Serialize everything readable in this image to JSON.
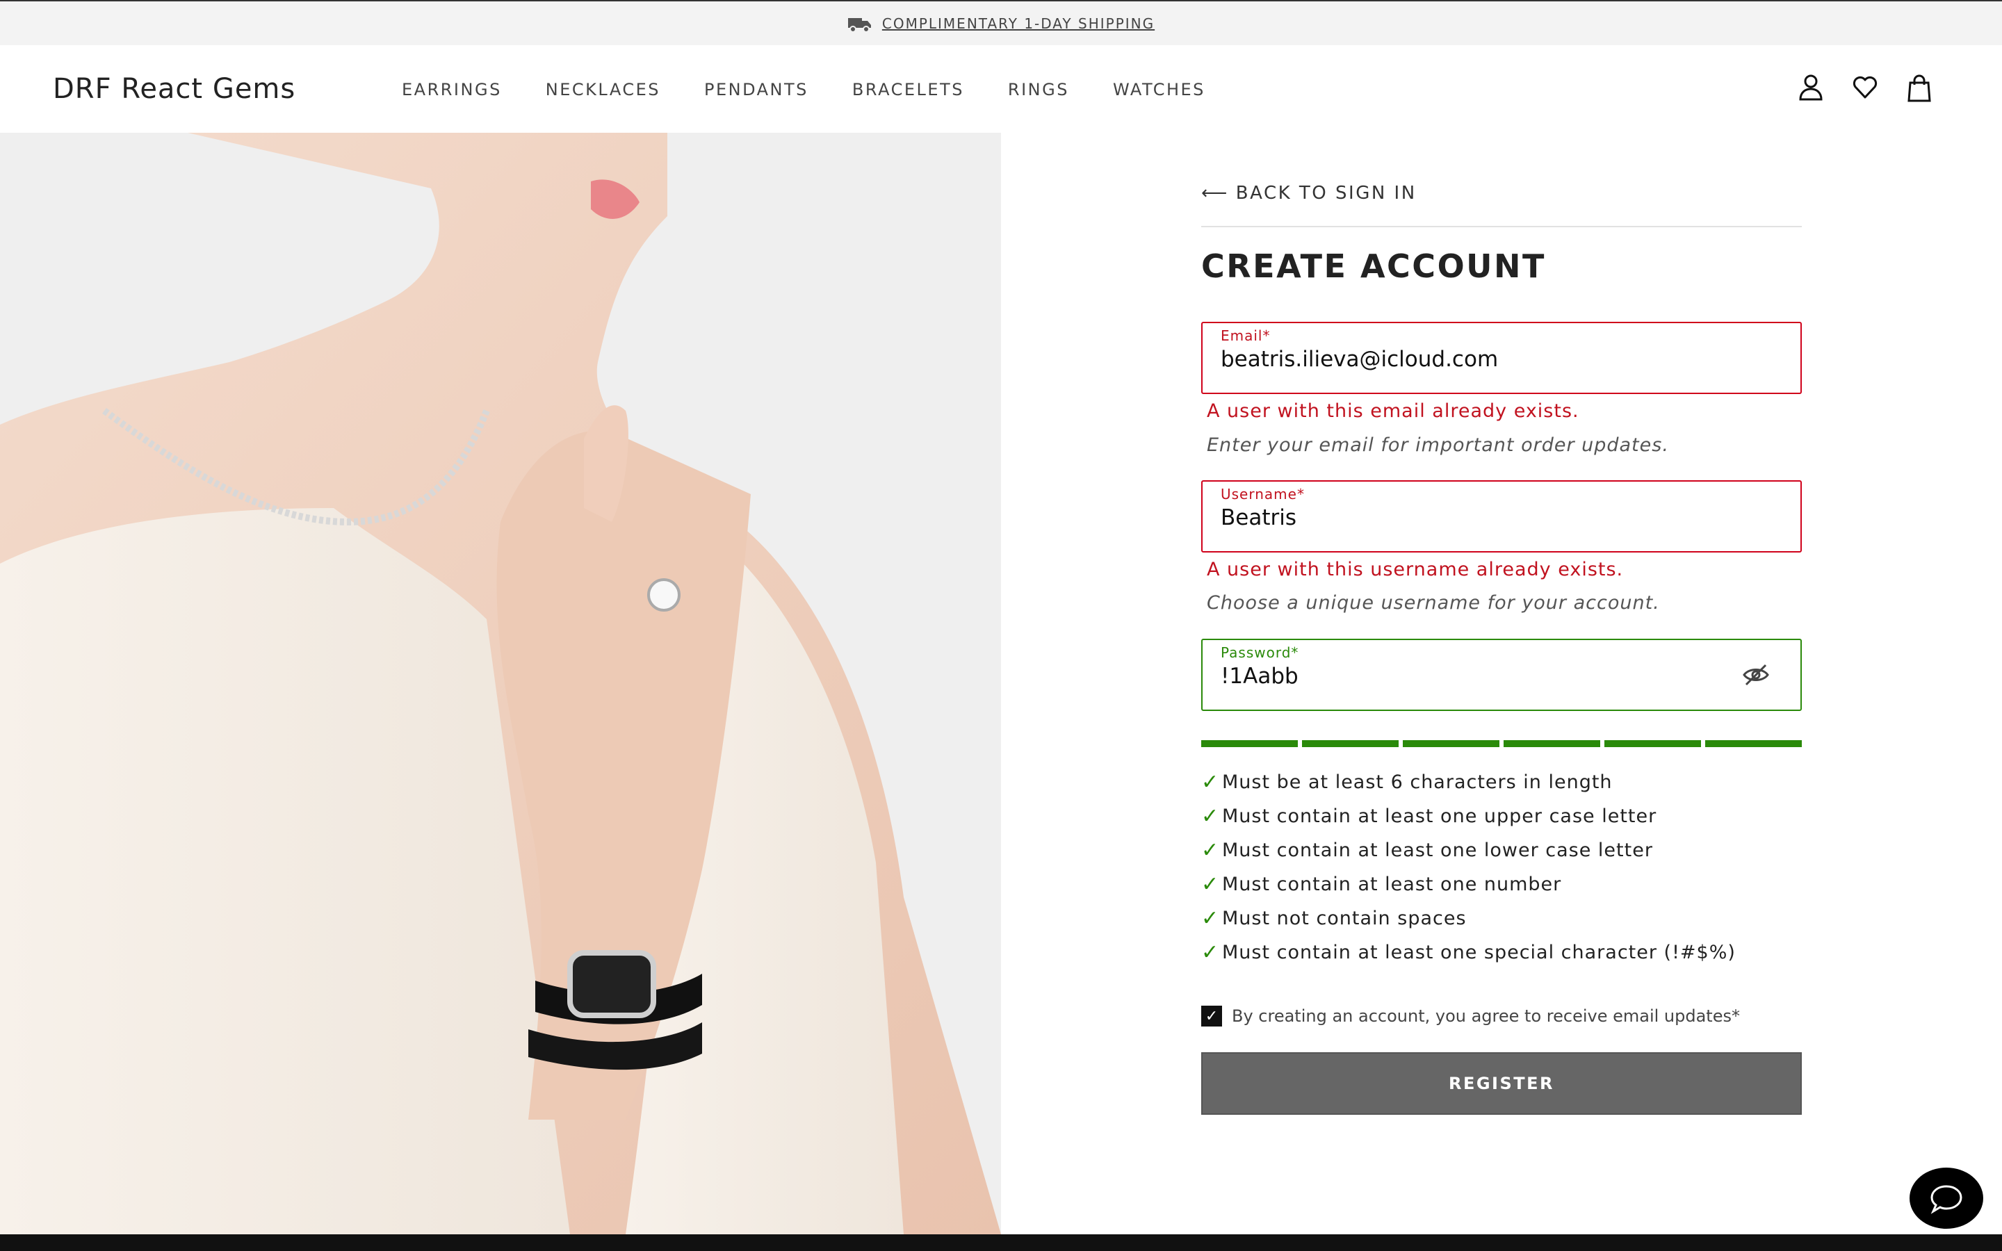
{
  "announcement": {
    "text": "COMPLIMENTARY 1-DAY SHIPPING",
    "icon": "truck-icon"
  },
  "header": {
    "logo": "DRF React Gems",
    "nav": [
      "EARRINGS",
      "NECKLACES",
      "PENDANTS",
      "BRACELETS",
      "RINGS",
      "WATCHES"
    ],
    "icons": [
      "user-icon",
      "heart-icon",
      "shopping-bag-icon"
    ]
  },
  "hero": {
    "description_icon": "model-jewelry-photo"
  },
  "form": {
    "back_link": "BACK TO SIGN IN",
    "title": "CREATE ACCOUNT",
    "email": {
      "label": "Email*",
      "value": "beatris.ilieva@icloud.com",
      "error": "A user with this email already exists.",
      "hint": "Enter your email for important order updates."
    },
    "username": {
      "label": "Username*",
      "value": "Beatris",
      "error": "A user with this username already exists.",
      "hint": "Choose a unique username for your account."
    },
    "password": {
      "label": "Password*",
      "value": "!1Aabb",
      "icon": "eye-off-icon"
    },
    "password_strength": {
      "segments_filled": 6,
      "segments_total": 6
    },
    "rules": [
      "Must be at least 6 characters in length",
      "Must contain at least one upper case letter",
      "Must contain at least one lower case letter",
      "Must contain at least one number",
      "Must not contain spaces",
      "Must contain at least one special character (!#$%)"
    ],
    "agree_text": "By creating an account, you agree to receive email updates*",
    "agree_checked": true,
    "register_label": "REGISTER"
  },
  "colors": {
    "error": "#c1121f",
    "success": "#2a8a0a",
    "button": "#666666"
  }
}
